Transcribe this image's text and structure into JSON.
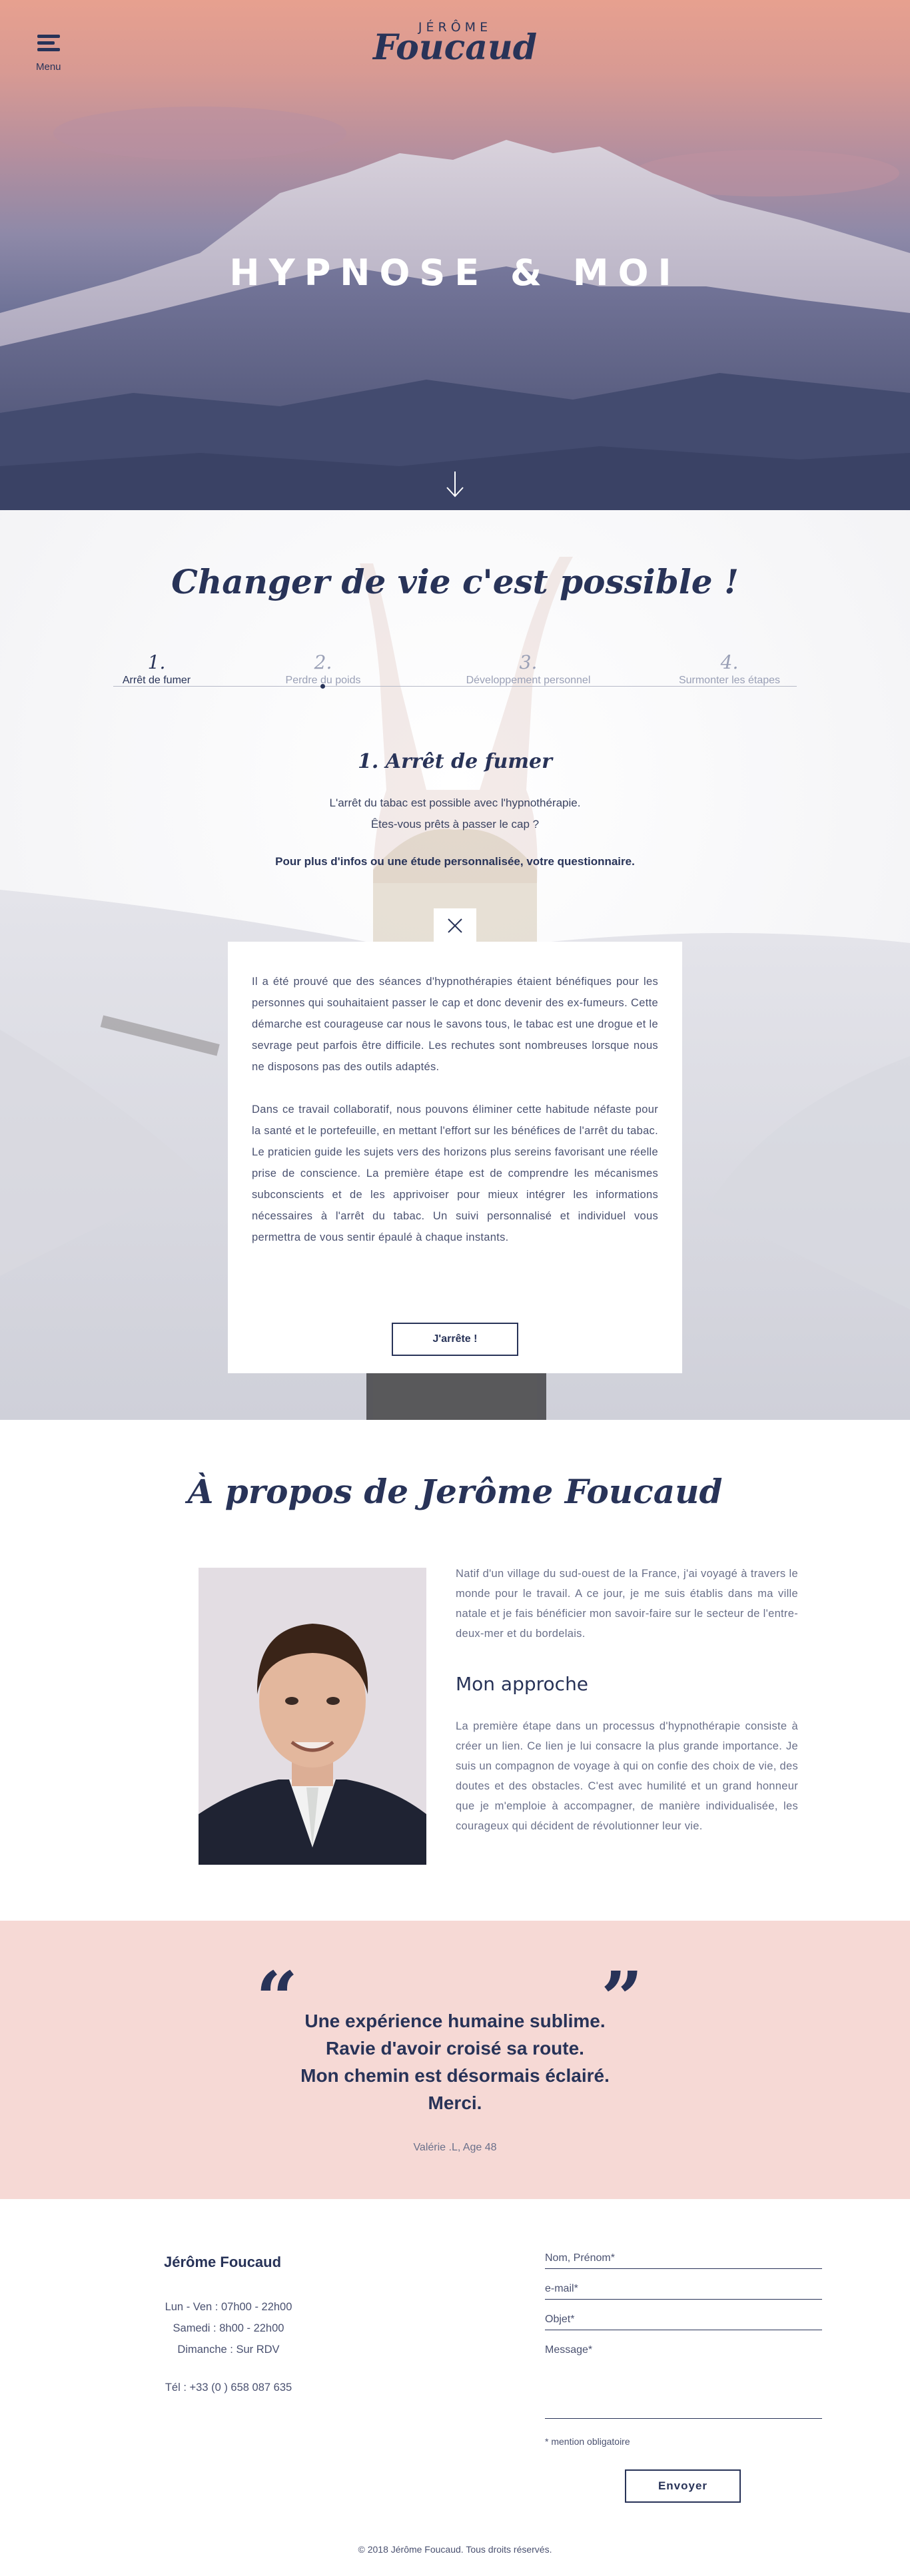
{
  "header": {
    "menu_label": "Menu",
    "logo_top": "JÉRÔME",
    "logo_main": "Foucaud"
  },
  "hero": {
    "title": "HYPNOSE & MOI"
  },
  "programs": {
    "title": "Changer de vie c'est possible !",
    "tabs": [
      {
        "num": "1.",
        "label": "Arrêt de fumer",
        "active": true
      },
      {
        "num": "2.",
        "label": "Perdre du poids",
        "active": false
      },
      {
        "num": "3.",
        "label": "Développement personnel",
        "active": false
      },
      {
        "num": "4.",
        "label": "Surmonter les étapes",
        "active": false
      }
    ],
    "subtitle": "1. Arrêt de fumer",
    "intro_line1": "L'arrêt du tabac est possible avec l'hypnothérapie.",
    "intro_line2": "Êtes-vous prêts à passer le cap ?",
    "cta_text": "Pour plus d'infos ou une étude personnalisée,",
    "cta_link": "votre questionnaire.",
    "card_p1": "Il a été prouvé que des séances d'hypnothérapies étaient bénéfiques pour les personnes qui souhaitaient passer le cap et donc devenir des ex-fumeurs. Cette démarche est courageuse car nous le savons tous, le tabac est une drogue et le sevrage peut parfois être difficile. Les rechutes sont nombreuses lorsque nous ne disposons pas des outils adaptés.",
    "card_p2": "Dans ce travail collaboratif, nous pouvons éliminer cette habitude néfaste pour la santé et le portefeuille, en mettant l'effort sur les bénéfices de l'arrêt du tabac. Le praticien guide les sujets vers des horizons plus sereins favorisant une réelle prise de conscience. La première étape est de comprendre les mécanismes subconscients et de les apprivoiser pour mieux intégrer les informations nécessaires à l'arrêt du tabac. Un suivi personnalisé et individuel vous permettra de vous sentir épaulé à chaque instants.",
    "button": "J'arrête !"
  },
  "about": {
    "title": "À propos de Jerôme Foucaud",
    "p1": "Natif d'un village du sud-ouest de la France, j'ai voyagé à travers le monde pour le travail. A ce jour, je me suis établis dans ma ville natale et je fais bénéficier mon savoir-faire sur le secteur de l'entre-deux-mer et du bordelais.",
    "approach_title": "Mon approche",
    "p2": "La première étape dans un processus d'hypnothérapie consiste à créer un lien. Ce lien je lui consacre la plus grande importance. Je suis un compagnon de voyage à qui on confie des choix de vie, des doutes et des obstacles. C'est avec humilité et un grand honneur que je m'emploie à accompagner, de manière individualisée, les courageux qui décident de révolutionner leur vie."
  },
  "testimonial": {
    "lines": [
      "Une expérience humaine sublime.",
      "Ravie d'avoir croisé sa route.",
      "Mon chemin est désormais éclairé.",
      "Merci."
    ],
    "author": "Valérie .L, Age 48"
  },
  "footer": {
    "name": "Jérôme Foucaud",
    "hours1": "Lun - Ven : 07h00 - 22h00",
    "hours2": "Samedi : 8h00 - 22h00",
    "hours3": "Dimanche : Sur RDV",
    "tel": "Tél : +33 (0 ) 658 087 635",
    "field_name": "Nom, Prénom*",
    "field_email": "e-mail*",
    "field_subject": "Objet*",
    "field_message": "Message*",
    "note": "* mention obligatoire",
    "send": "Envoyer",
    "copyright": "© 2018 Jérôme Foucaud. Tous droits réservés."
  }
}
